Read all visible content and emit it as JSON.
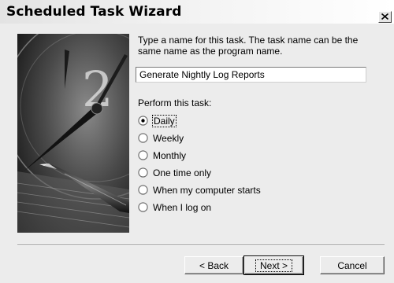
{
  "window": {
    "title": "Scheduled Task Wizard",
    "close_glyph": "close-x-icon"
  },
  "content": {
    "prompt": "Type a name for this task.  The task name can be the same name as the program name.",
    "task_name_value": "Generate Nightly Log Reports",
    "perform_label": "Perform this task:",
    "options": [
      {
        "label": "Daily",
        "selected": true
      },
      {
        "label": "Weekly",
        "selected": false
      },
      {
        "label": "Monthly",
        "selected": false
      },
      {
        "label": "One time only",
        "selected": false
      },
      {
        "label": "When my computer starts",
        "selected": false
      },
      {
        "label": "When I log on",
        "selected": false
      }
    ]
  },
  "buttons": {
    "back": "< Back",
    "next": "Next >",
    "cancel": "Cancel"
  },
  "colors": {
    "dialog_bg": "#ececec",
    "title_gradient_start": "#e3e3e3"
  }
}
